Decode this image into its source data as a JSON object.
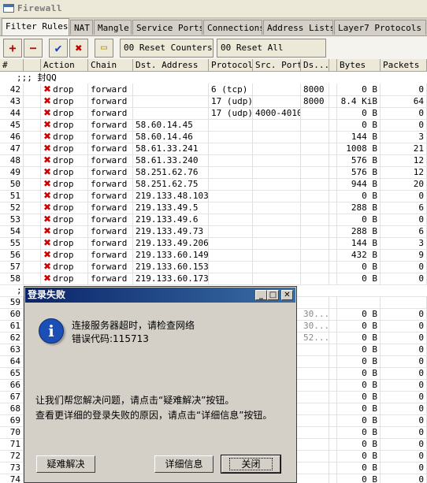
{
  "window": {
    "title": "Firewall"
  },
  "tabs": [
    "Filter Rules",
    "NAT",
    "Mangle",
    "Service Ports",
    "Connections",
    "Address Lists",
    "Layer7 Protocols"
  ],
  "toolbar": {
    "add": "+",
    "remove": "−",
    "enable": "✔",
    "disable": "✖",
    "comment": "▭",
    "reset_counters": "00 Reset Counters",
    "reset_all_counters": "00 Reset All Counters"
  },
  "columns": [
    "#",
    "Action",
    "Chain",
    "Dst. Address",
    "Protocol",
    "Src. Port",
    "Ds...",
    "Bytes",
    "Packets"
  ],
  "comment_row": ";;; 封QQ",
  "rows": [
    {
      "n": "42",
      "action": "drop",
      "chain": "forward",
      "dst": "",
      "proto": "6 (tcp)",
      "sport": "",
      "dport": "8000",
      "bytes": "0 B",
      "packets": "0"
    },
    {
      "n": "43",
      "action": "drop",
      "chain": "forward",
      "dst": "",
      "proto": "17 (udp)",
      "sport": "",
      "dport": "8000",
      "bytes": "8.4 KiB",
      "packets": "64"
    },
    {
      "n": "44",
      "action": "drop",
      "chain": "forward",
      "dst": "",
      "proto": "17 (udp)",
      "sport": "4000-4010",
      "dport": "",
      "bytes": "0 B",
      "packets": "0"
    },
    {
      "n": "45",
      "action": "drop",
      "chain": "forward",
      "dst": "58.60.14.45",
      "proto": "",
      "sport": "",
      "dport": "",
      "bytes": "0 B",
      "packets": "0"
    },
    {
      "n": "46",
      "action": "drop",
      "chain": "forward",
      "dst": "58.60.14.46",
      "proto": "",
      "sport": "",
      "dport": "",
      "bytes": "144 B",
      "packets": "3"
    },
    {
      "n": "47",
      "action": "drop",
      "chain": "forward",
      "dst": "58.61.33.241",
      "proto": "",
      "sport": "",
      "dport": "",
      "bytes": "1008 B",
      "packets": "21"
    },
    {
      "n": "48",
      "action": "drop",
      "chain": "forward",
      "dst": "58.61.33.240",
      "proto": "",
      "sport": "",
      "dport": "",
      "bytes": "576 B",
      "packets": "12"
    },
    {
      "n": "49",
      "action": "drop",
      "chain": "forward",
      "dst": "58.251.62.76",
      "proto": "",
      "sport": "",
      "dport": "",
      "bytes": "576 B",
      "packets": "12"
    },
    {
      "n": "50",
      "action": "drop",
      "chain": "forward",
      "dst": "58.251.62.75",
      "proto": "",
      "sport": "",
      "dport": "",
      "bytes": "944 B",
      "packets": "20"
    },
    {
      "n": "51",
      "action": "drop",
      "chain": "forward",
      "dst": "219.133.48.103",
      "proto": "",
      "sport": "",
      "dport": "",
      "bytes": "0 B",
      "packets": "0"
    },
    {
      "n": "52",
      "action": "drop",
      "chain": "forward",
      "dst": "219.133.49.5",
      "proto": "",
      "sport": "",
      "dport": "",
      "bytes": "288 B",
      "packets": "6"
    },
    {
      "n": "53",
      "action": "drop",
      "chain": "forward",
      "dst": "219.133.49.6",
      "proto": "",
      "sport": "",
      "dport": "",
      "bytes": "0 B",
      "packets": "0"
    },
    {
      "n": "54",
      "action": "drop",
      "chain": "forward",
      "dst": "219.133.49.73",
      "proto": "",
      "sport": "",
      "dport": "",
      "bytes": "288 B",
      "packets": "6"
    },
    {
      "n": "55",
      "action": "drop",
      "chain": "forward",
      "dst": "219.133.49.206",
      "proto": "",
      "sport": "",
      "dport": "",
      "bytes": "144 B",
      "packets": "3"
    },
    {
      "n": "56",
      "action": "drop",
      "chain": "forward",
      "dst": "219.133.60.149",
      "proto": "",
      "sport": "",
      "dport": "",
      "bytes": "432 B",
      "packets": "9"
    },
    {
      "n": "57",
      "action": "drop",
      "chain": "forward",
      "dst": "219.133.60.153",
      "proto": "",
      "sport": "",
      "dport": "",
      "bytes": "0 B",
      "packets": "0"
    },
    {
      "n": "58",
      "action": "drop",
      "chain": "forward",
      "dst": "219.133.60.173",
      "proto": "",
      "sport": "",
      "dport": "",
      "bytes": "0 B",
      "packets": "0"
    }
  ],
  "lower_comment": ";",
  "lower_rows": [
    {
      "n": "59",
      "dport": "",
      "bytes": "",
      "packets": ""
    },
    {
      "n": "60",
      "dport": "30...",
      "bytes": "0 B",
      "packets": "0"
    },
    {
      "n": "61",
      "dport": "30...",
      "bytes": "0 B",
      "packets": "0"
    },
    {
      "n": "62",
      "dport": "52...",
      "bytes": "0 B",
      "packets": "0"
    },
    {
      "n": "63",
      "dport": "",
      "bytes": "0 B",
      "packets": "0"
    },
    {
      "n": "64",
      "dport": "",
      "bytes": "0 B",
      "packets": "0"
    },
    {
      "n": "65",
      "dport": "",
      "bytes": "0 B",
      "packets": "0"
    },
    {
      "n": "66",
      "dport": "",
      "bytes": "0 B",
      "packets": "0"
    },
    {
      "n": "67",
      "dport": "",
      "bytes": "0 B",
      "packets": "0"
    },
    {
      "n": "68",
      "dport": "",
      "bytes": "0 B",
      "packets": "0"
    },
    {
      "n": "69",
      "dport": "",
      "bytes": "0 B",
      "packets": "0"
    },
    {
      "n": "70",
      "dport": "",
      "bytes": "0 B",
      "packets": "0"
    },
    {
      "n": "71",
      "dport": "",
      "bytes": "0 B",
      "packets": "0"
    },
    {
      "n": "72",
      "dport": "",
      "bytes": "0 B",
      "packets": "0"
    },
    {
      "n": "73",
      "dport": "",
      "bytes": "0 B",
      "packets": "0"
    },
    {
      "n": "74",
      "dport": "",
      "bytes": "0 B",
      "packets": "0"
    }
  ],
  "dialog": {
    "title": "登录失败",
    "line1": "连接服务器超时，请检查网络",
    "line2": "错误代码:115713",
    "line3": "让我们帮您解决问题，请点击“疑难解决”按钮。",
    "line4": "查看更详细的登录失败的原因，请点击“详细信息”按钮。",
    "btn_troubleshoot": "疑难解决",
    "btn_details": "详细信息",
    "btn_close": "关闭",
    "min": "_",
    "max": "□",
    "close": "✕"
  }
}
